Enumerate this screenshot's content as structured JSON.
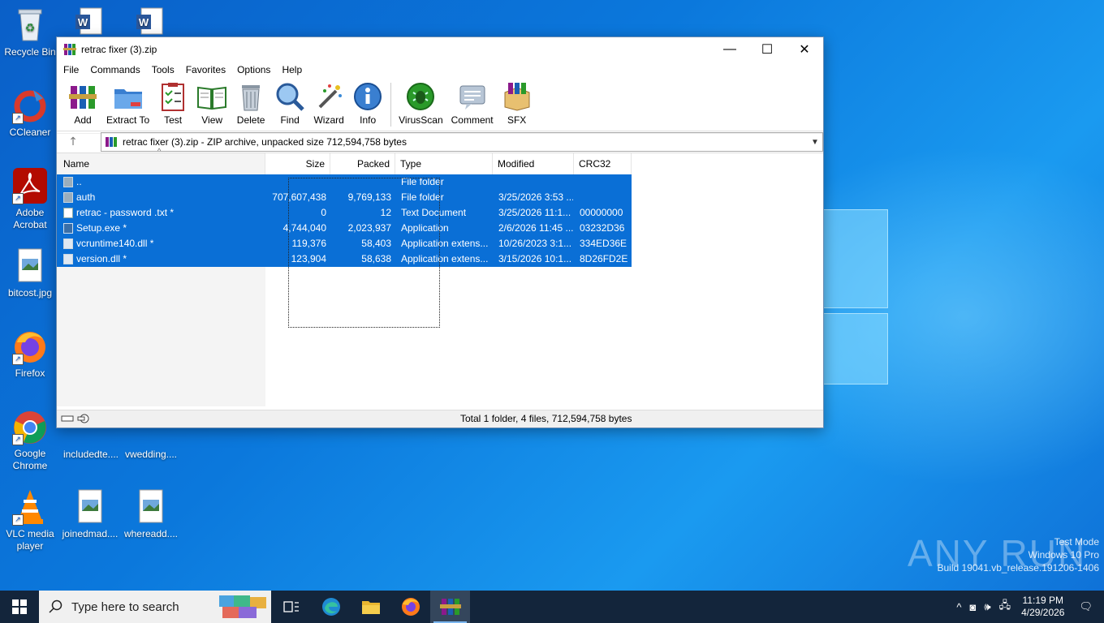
{
  "desktop": {
    "icons": [
      {
        "label": "Recycle Bin",
        "icon": "recycle-bin-icon"
      },
      {
        "label": "CCleaner",
        "icon": "ccleaner-icon"
      },
      {
        "label": "Adobe Acrobat",
        "icon": "acrobat-icon"
      },
      {
        "label": "bitcost.jpg",
        "icon": "image-file-icon"
      },
      {
        "label": "Firefox",
        "icon": "firefox-icon"
      },
      {
        "label": "Google Chrome",
        "icon": "chrome-icon"
      },
      {
        "label": "VLC media player",
        "icon": "vlc-icon"
      },
      {
        "label": "includedte....",
        "icon": "word-doc-icon"
      },
      {
        "label": "vwedding....",
        "icon": "image-file-icon"
      },
      {
        "label": "joinedmad....",
        "icon": "image-file-icon"
      },
      {
        "label": "whereadd....",
        "icon": "image-file-icon"
      }
    ],
    "watermark": {
      "brand": "ANY RUN",
      "line1": "Test Mode",
      "line2": "Windows 10 Pro",
      "line3": "Build 19041.vb_release.191206-1406"
    }
  },
  "window": {
    "title": "retrac fixer (3).zip",
    "controls": {
      "minimize": "—",
      "maximize": "☐",
      "close": "✕"
    },
    "menu": [
      "File",
      "Commands",
      "Tools",
      "Favorites",
      "Options",
      "Help"
    ],
    "toolbar": [
      {
        "label": "Add",
        "icon": "add-archive-icon"
      },
      {
        "label": "Extract To",
        "icon": "extract-folder-icon"
      },
      {
        "label": "Test",
        "icon": "test-clipboard-icon"
      },
      {
        "label": "View",
        "icon": "view-book-icon"
      },
      {
        "label": "Delete",
        "icon": "trash-icon"
      },
      {
        "label": "Find",
        "icon": "magnifier-icon"
      },
      {
        "label": "Wizard",
        "icon": "wand-icon"
      },
      {
        "label": "Info",
        "icon": "info-icon"
      },
      {
        "label": "VirusScan",
        "icon": "virus-scan-icon"
      },
      {
        "label": "Comment",
        "icon": "comment-icon"
      },
      {
        "label": "SFX",
        "icon": "sfx-box-icon"
      }
    ],
    "path": "retrac fixer (3).zip - ZIP archive, unpacked size 712,594,758 bytes",
    "columns": {
      "name": "Name",
      "size": "Size",
      "packed": "Packed",
      "type": "Type",
      "modified": "Modified",
      "crc": "CRC32"
    },
    "files": [
      {
        "name": "..",
        "size": "",
        "packed": "",
        "type": "File folder",
        "modified": "",
        "crc": ""
      },
      {
        "name": "auth",
        "size": "707,607,438",
        "packed": "9,769,133",
        "type": "File folder",
        "modified": "3/25/2026 3:53 ...",
        "crc": ""
      },
      {
        "name": "retrac - password .txt *",
        "size": "0",
        "packed": "12",
        "type": "Text Document",
        "modified": "3/25/2026 11:1...",
        "crc": "00000000"
      },
      {
        "name": "Setup.exe *",
        "size": "4,744,040",
        "packed": "2,023,937",
        "type": "Application",
        "modified": "2/6/2026 11:45 ...",
        "crc": "03232D36"
      },
      {
        "name": "vcruntime140.dll *",
        "size": "119,376",
        "packed": "58,403",
        "type": "Application extens...",
        "modified": "10/26/2023 3:1...",
        "crc": "334ED36E"
      },
      {
        "name": "version.dll *",
        "size": "123,904",
        "packed": "58,638",
        "type": "Application extens...",
        "modified": "3/15/2026 10:1...",
        "crc": "8D26FD2E"
      }
    ],
    "status": "Total 1 folder, 4 files, 712,594,758 bytes"
  },
  "taskbar": {
    "search_placeholder": "Type here to search",
    "time": "11:19 PM",
    "date": "4/29/2026"
  }
}
